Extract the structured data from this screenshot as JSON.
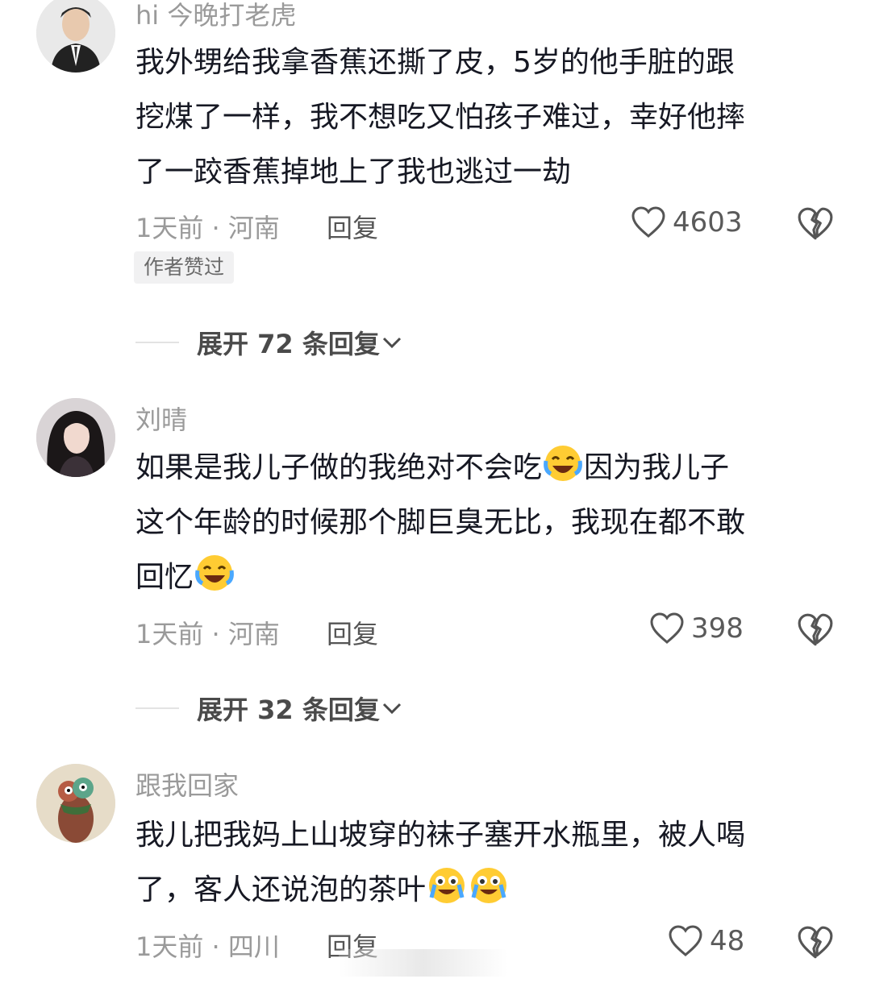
{
  "comments": [
    {
      "username": "hi 今晚打老虎",
      "lines": [
        "我外甥给我拿香蕉还撕了皮，5岁的他手脏的跟",
        "挖煤了一样，我不想吃又怕孩子难过，幸好他摔",
        "了一跤香蕉掉地上了我也逃过一劫"
      ],
      "time_location": "1天前 · 河南",
      "reply_label": "回复",
      "likes": "4603",
      "badge": "作者赞过",
      "expand_label": "展开 72 条回复"
    },
    {
      "username": "刘晴",
      "line1_a": "如果是我儿子做的我绝对不会吃",
      "line1_b": "因为我儿子",
      "line2": "这个年龄的时候那个脚巨臭无比，我现在都不敢",
      "line3": "回忆",
      "time_location": "1天前 · 河南",
      "reply_label": "回复",
      "likes": "398",
      "expand_label": "展开 32 条回复"
    },
    {
      "username": "跟我回家",
      "line1": "我儿把我妈上山坡穿的袜子塞开水瓶里，被人喝",
      "line2": "了，客人还说泡的茶叶",
      "time_location": "1天前 · 四川",
      "reply_label": "回复",
      "likes": "48"
    }
  ],
  "icons": {
    "heart": "heart-icon",
    "dislike": "broken-heart-icon",
    "laugh_emoji": "laughing-tears-emoji",
    "cry_emoji": "crying-laughing-emoji",
    "chevron": "chevron-down-icon"
  }
}
